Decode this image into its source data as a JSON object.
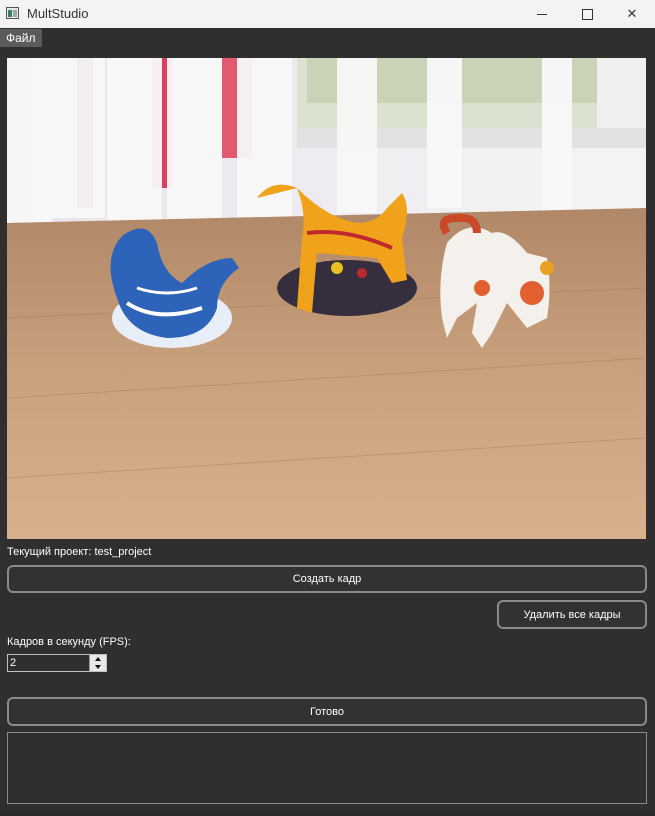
{
  "window": {
    "title": "MultStudio",
    "icon": "app-icon"
  },
  "menu": {
    "file": "Файл"
  },
  "project": {
    "label": "Текущий проект: test_project"
  },
  "buttons": {
    "create_frame": "Создать кадр",
    "delete_all_frames": "Удалить все кадры",
    "ready": "Готово"
  },
  "fps": {
    "label": "Кадров в секунду (FPS):",
    "value": "2"
  },
  "log": {
    "text": ""
  },
  "colors": {
    "background": "#2f2f2f",
    "button_border": "#8a8a8a",
    "titlebar": "#f3f3f3"
  }
}
